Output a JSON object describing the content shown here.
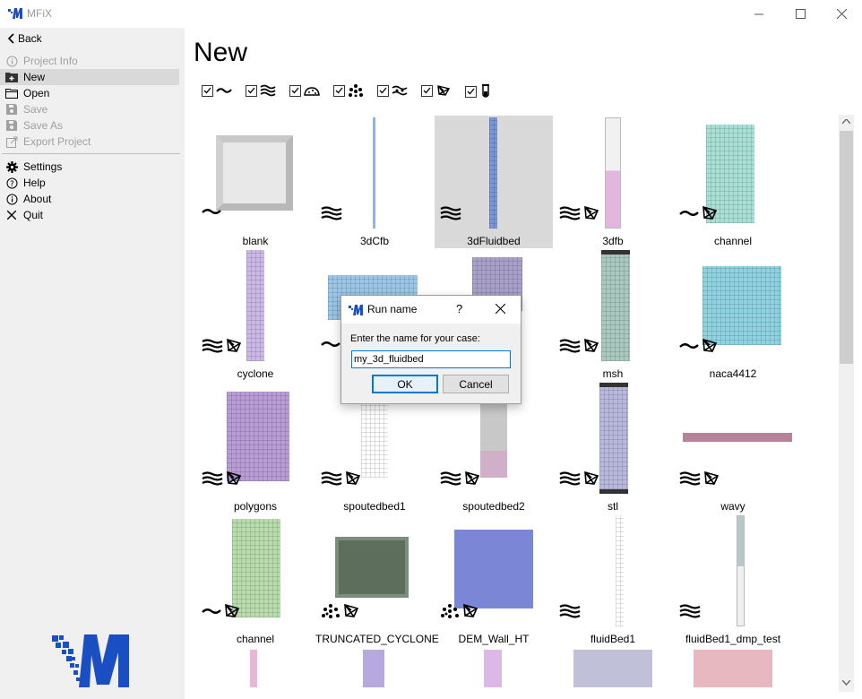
{
  "window": {
    "title": "MFiX"
  },
  "sidebar": {
    "back_label": "Back",
    "items": [
      {
        "label": "Project Info",
        "icon": "info-icon"
      },
      {
        "label": "New",
        "icon": "new-project-icon"
      },
      {
        "label": "Open",
        "icon": "folder-icon"
      },
      {
        "label": "Save",
        "icon": "save-icon"
      },
      {
        "label": "Save As",
        "icon": "save-as-icon"
      },
      {
        "label": "Export Project",
        "icon": "export-icon"
      },
      {
        "label": "Settings",
        "icon": "gear-icon"
      },
      {
        "label": "Help",
        "icon": "help-icon"
      },
      {
        "label": "About",
        "icon": "about-icon"
      },
      {
        "label": "Quit",
        "icon": "close-icon"
      }
    ]
  },
  "main": {
    "title": "New",
    "filters": [
      "single-phase-icon",
      "tfm-icon",
      "pic-icon",
      "dem-icon",
      "cgp-icon",
      "cartesian-icon",
      "chemistry-icon"
    ],
    "templates": [
      {
        "label": "blank"
      },
      {
        "label": "3dCfb"
      },
      {
        "label": "3dFluidbed"
      },
      {
        "label": "3dfb"
      },
      {
        "label": "channel"
      },
      {
        "label": "cyclone"
      },
      {
        "label": ""
      },
      {
        "label": ""
      },
      {
        "label": "msh"
      },
      {
        "label": "naca4412"
      },
      {
        "label": "polygons"
      },
      {
        "label": "spoutedbed1"
      },
      {
        "label": "spoutedbed2"
      },
      {
        "label": "stl"
      },
      {
        "label": "wavy"
      },
      {
        "label": "channel"
      },
      {
        "label": "TRUNCATED_CYCLONE"
      },
      {
        "label": "DEM_Wall_HT"
      },
      {
        "label": "fluidBed1"
      },
      {
        "label": "fluidBed1_dmp_test"
      }
    ]
  },
  "dialog": {
    "title": "Run name",
    "help": "?",
    "prompt": "Enter the name for your case:",
    "input_value": "my_3d_fluidbed",
    "ok_label": "OK",
    "cancel_label": "Cancel"
  },
  "colors": {
    "accent": "#0078d7",
    "logo": "#1a4fc4"
  }
}
